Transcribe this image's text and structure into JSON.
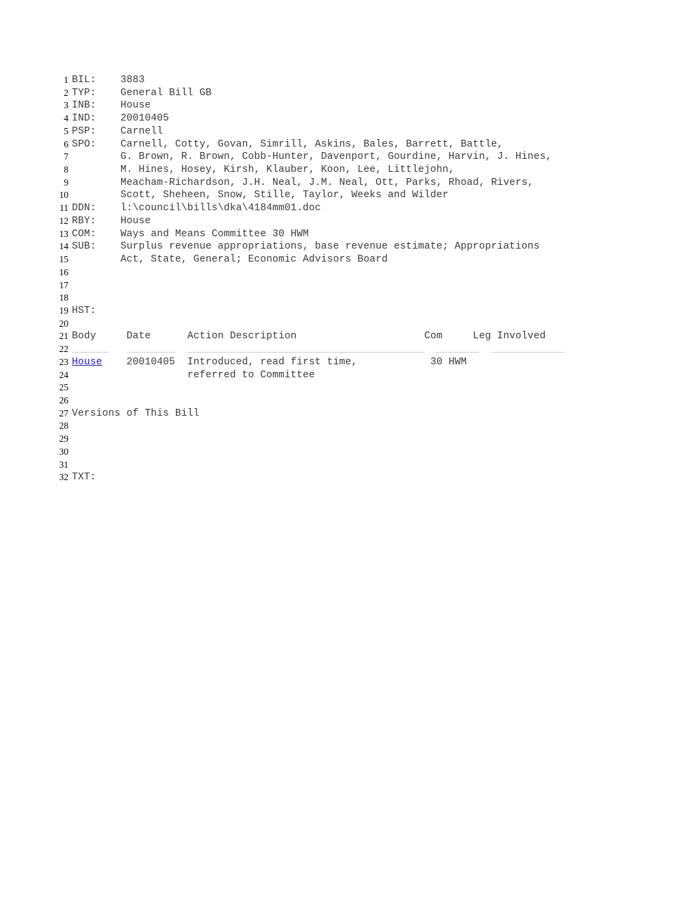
{
  "document": {
    "type": "legislative-bill-record",
    "line_count": 32
  },
  "fields": {
    "bill_label": "BIL:",
    "bill_number": "3883",
    "type_label": "TYP:",
    "type_value": "General Bill GB",
    "introduced_by_label": "INB:",
    "introduced_by_value": "House",
    "introduced_date_label": "IND:",
    "introduced_date_value": "20010405",
    "primary_sponsor_label": "PSP:",
    "primary_sponsor_value": "Carnell",
    "sponsors_label": "SPO:",
    "document_name_label": "DDN:",
    "document_name_value": "l:\\council\\bills\\dka\\4184mm01.doc",
    "reported_by_label": "RBY:",
    "reported_by_value": "House",
    "committee_label": "COM:",
    "committee_value": "Ways and Means Committee 30 HWM",
    "subject_label": "SUB:",
    "history_label": "HST:",
    "text_label": "TXT:"
  },
  "sponsors": [
    "Carnell, Cotty, Govan, Simrill, Askins, Bales, Barrett, Battle,",
    "G. Brown, R. Brown, Cobb-Hunter, Davenport, Gourdine, Harvin, J. Hines,",
    "M. Hines, Hosey, Kirsh, Klauber, Koon, Lee, Littlejohn,",
    "Meacham-Richardson, J.H. Neal, J.M. Neal, Ott, Parks, Rhoad, Rivers,",
    "Scott, Sheheen, Snow, Stille, Taylor, Weeks and Wilder"
  ],
  "subject_lines": [
    "Surplus revenue appropriations, base revenue estimate; Appropriations",
    "Act, State, General; Economic Advisors Board"
  ],
  "history_table": {
    "headers": {
      "body": "Body",
      "date": "Date",
      "action_description": "Action Description",
      "com": "Com",
      "leg_involved": "Leg Involved"
    },
    "separators": {
      "body": "______",
      "date": "________",
      "action_description": "_______________________________________",
      "com": "_______",
      "leg_involved": "____________"
    },
    "rows": [
      {
        "body": "House",
        "body_is_link": true,
        "date": "20010405",
        "action_description_line1": "Introduced, read first time,",
        "action_description_line2": "referred to Committee",
        "com": "30 HWM",
        "leg_involved": ""
      }
    ]
  },
  "versions_heading": "Versions of This Bill",
  "line_numbers": [
    "1",
    "2",
    "3",
    "4",
    "5",
    "6",
    "7",
    "8",
    "9",
    "10",
    "11",
    "12",
    "13",
    "14",
    "15",
    "16",
    "17",
    "18",
    "19",
    "20",
    "21",
    "22",
    "23",
    "24",
    "25",
    "26",
    "27",
    "28",
    "29",
    "30",
    "31",
    "32"
  ],
  "colors": {
    "text": "#3a3a3a",
    "line_number": "#000000",
    "link": "#1a1ae6",
    "rule": "#b9b9b9",
    "background": "#ffffff"
  }
}
